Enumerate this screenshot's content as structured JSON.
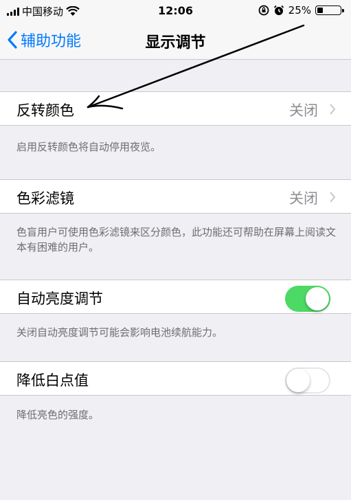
{
  "status_bar": {
    "carrier": "中国移动",
    "time": "12:06",
    "battery_percent": "25%",
    "battery_level": 0.25
  },
  "nav": {
    "back_label": "辅助功能",
    "title": "显示调节"
  },
  "settings": [
    {
      "label": "反转颜色",
      "value": "关闭",
      "footer": "启用反转颜色将自动停用夜览。"
    },
    {
      "label": "色彩滤镜",
      "value": "关闭",
      "footer": "色盲用户可使用色彩滤镜来区分颜色，此功能还可帮助在屏幕上阅读文本有困难的用户。"
    },
    {
      "label": "自动亮度调节",
      "toggle": true,
      "footer": "关闭自动亮度调节可能会影响电池续航能力。"
    },
    {
      "label": "降低白点值",
      "toggle": false,
      "footer": "降低亮色的强度。"
    }
  ],
  "colors": {
    "accent": "#007aff",
    "switch_on": "#4cd964",
    "background": "#efeff4",
    "annotation_arrow": "#000000"
  }
}
